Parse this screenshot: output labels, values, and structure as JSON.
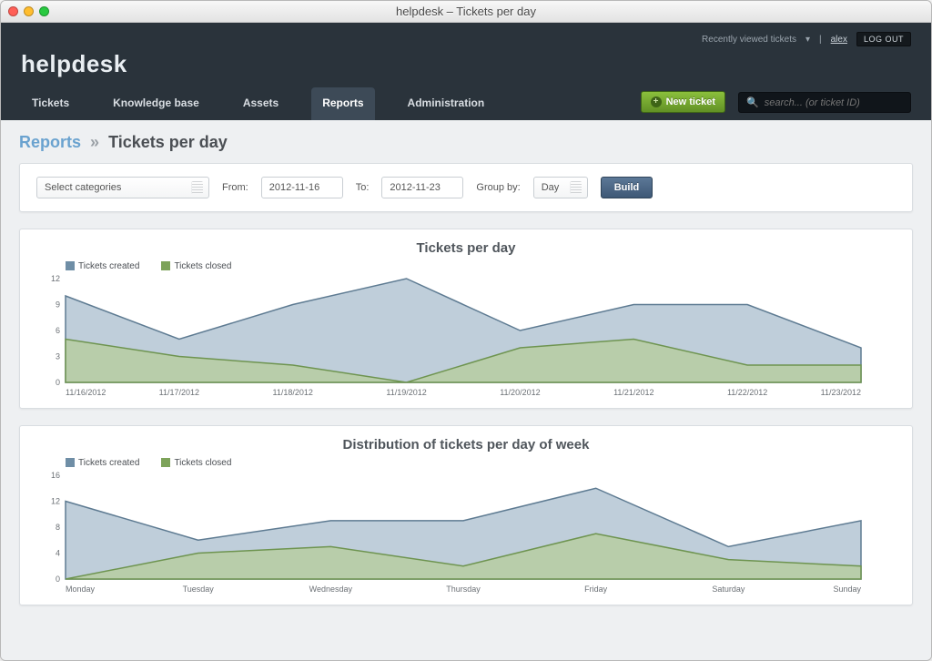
{
  "window_title": "helpdesk – Tickets per day",
  "brand": "helpdesk",
  "top_links": {
    "recent": "Recently viewed tickets",
    "user": "alex",
    "logout": "LOG OUT"
  },
  "nav": [
    "Tickets",
    "Knowledge base",
    "Assets",
    "Reports",
    "Administration"
  ],
  "nav_active": 3,
  "new_ticket": "New ticket",
  "search_placeholder": "search... (or ticket ID)",
  "breadcrumb": {
    "root": "Reports",
    "page": "Tickets per day"
  },
  "filters": {
    "category_label": "Select categories",
    "from_label": "From:",
    "from": "2012-11-16",
    "to_label": "To:",
    "to": "2012-11-23",
    "groupby_label": "Group by:",
    "groupby": "Day",
    "build": "Build"
  },
  "legend": {
    "s1": "Tickets created",
    "s2": "Tickets closed"
  },
  "colors": {
    "s1": "#6f8ea6",
    "s2": "#7da35a"
  },
  "chart_data": [
    {
      "type": "area",
      "title": "Tickets per day",
      "xlabel": "",
      "ylabel": "",
      "y_ticks": [
        0,
        3,
        6,
        9,
        12
      ],
      "ylim": [
        0,
        12
      ],
      "categories": [
        "11/16/2012",
        "11/17/2012",
        "11/18/2012",
        "11/19/2012",
        "11/20/2012",
        "11/21/2012",
        "11/22/2012",
        "11/23/2012"
      ],
      "series": [
        {
          "name": "Tickets created",
          "values": [
            10,
            5,
            9,
            12,
            6,
            9,
            9,
            4
          ]
        },
        {
          "name": "Tickets closed",
          "values": [
            5,
            3,
            2,
            0,
            4,
            5,
            2,
            2
          ]
        }
      ]
    },
    {
      "type": "area",
      "title": "Distribution of tickets per day of week",
      "xlabel": "",
      "ylabel": "",
      "y_ticks": [
        0,
        4,
        8,
        12,
        16
      ],
      "ylim": [
        0,
        16
      ],
      "categories": [
        "Monday",
        "Tuesday",
        "Wednesday",
        "Thursday",
        "Friday",
        "Saturday",
        "Sunday"
      ],
      "series": [
        {
          "name": "Tickets created",
          "values": [
            12,
            6,
            9,
            9,
            14,
            5,
            9
          ]
        },
        {
          "name": "Tickets closed",
          "values": [
            0,
            4,
            5,
            2,
            7,
            3,
            2
          ]
        }
      ]
    }
  ]
}
